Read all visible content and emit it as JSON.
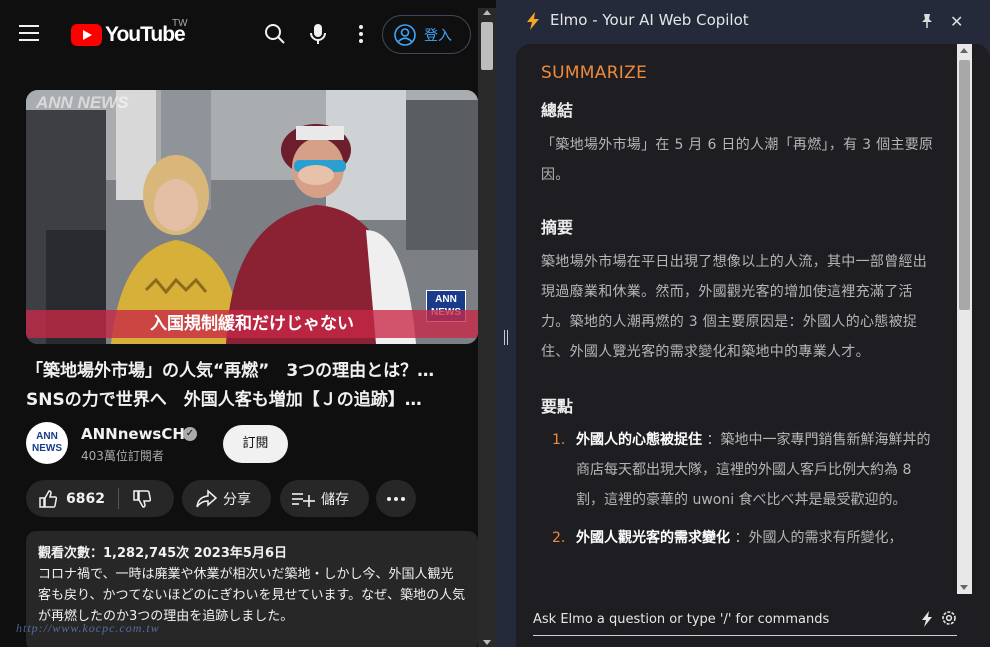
{
  "youtube": {
    "logo_text": "YouTube",
    "region": "TW",
    "signin_label": "登入",
    "thumbnail": {
      "caption": "入国規制緩和だけじゃない",
      "watermark": "ANN NEWS",
      "badge": "ANN NEWS"
    },
    "title_line1": "「築地場外市場」の人気“再燃”　3つの理由とは？…",
    "title_line2": "SNSの力で世界へ　外国人客も増加【Ｊの追跡】…",
    "channel": {
      "avatar_text": "ANN NEWS",
      "name": "ANNnewsCH",
      "subs": "403萬位訂閱者",
      "subscribe_label": "訂閱"
    },
    "actions": {
      "likes": "6862",
      "share": "分享",
      "save": "儲存"
    },
    "description": {
      "meta": "觀看次數：1,282,745次  2023年5月6日",
      "text": "コロナ禍で、一時は廃業や休業が相次いだ築地・しかし今、外国人観光客も戻り、かつてないほどのにぎわいを見せています。なぜ、築地の人気が再燃したのか3つの理由を追跡しました。"
    },
    "watermark": "http://www.kocpc.com.tw"
  },
  "elmo": {
    "title": "Elmo - Your AI Web Copilot",
    "section_label": "SUMMARIZE",
    "summary_heading": "總結",
    "summary_text": "「築地場外市場」在 5 月 6 日的人潮「再燃」，有 3 個主要原因。",
    "abstract_heading": "摘要",
    "abstract_text": "築地場外市場在平日出現了想像以上的人流，其中一部曾經出現過廢業和休業。然而，外國觀光客的增加使這裡充滿了活力。築地的人潮再燃的 3 個主要原因是：外國人的心態被捉住、外國人覽光客的需求變化和築地中的專業人才。",
    "points_heading": "要點",
    "points": [
      {
        "num": "1.",
        "title": "外國人的心態被捉住",
        "text": "：築地中一家專門銷售新鮮海鮮丼的商店每天都出現大隊，這裡的外國人客戶比例大約為 8 割，這裡的豪華的 uwoni 食べ比べ丼是最受歡迎的。"
      },
      {
        "num": "2.",
        "title": "外國人觀光客的需求變化",
        "text": "：外國人的需求有所變化，"
      }
    ],
    "input_placeholder": "Ask Elmo a question or type '/' for commands"
  }
}
